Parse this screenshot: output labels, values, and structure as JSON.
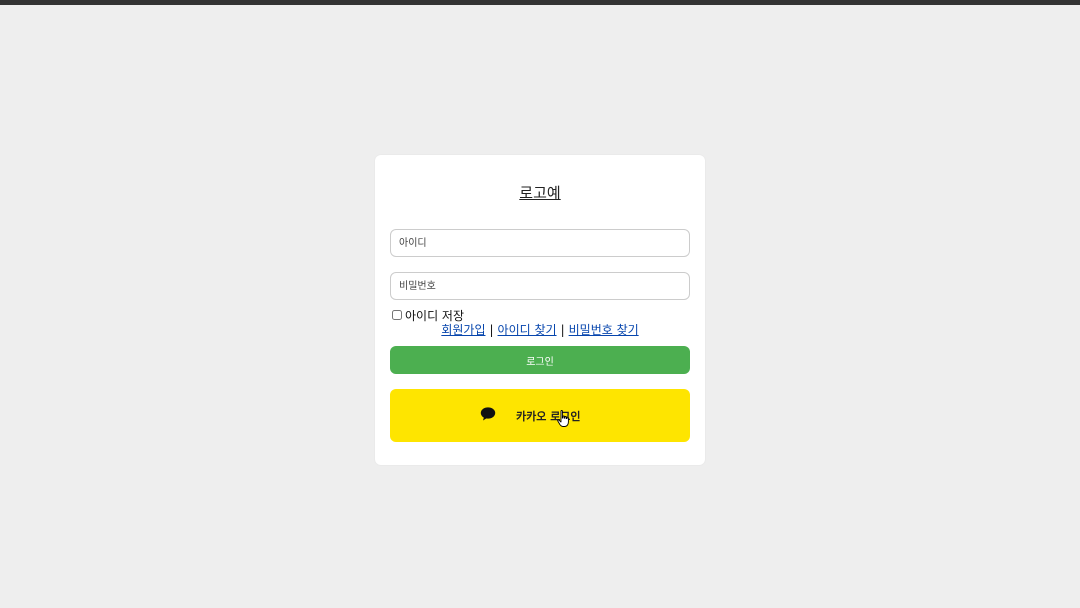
{
  "header": {
    "logo_text": "로고예"
  },
  "login_form": {
    "id_placeholder": "아이디",
    "password_placeholder": "비밀번호",
    "remember_label": "아이디 저장",
    "links": {
      "signup": "회원가입",
      "find_id": "아이디 찾기",
      "find_password": "비밀번호 찾기",
      "separator": "|"
    },
    "login_button": "로그인",
    "kakao_button": "카카오 로그인"
  },
  "colors": {
    "background": "#eeeeee",
    "card": "#ffffff",
    "login_button": "#4caf50",
    "kakao_button": "#fee500",
    "link": "#0645ad"
  },
  "icons": {
    "kakao": "speech-bubble-icon",
    "cursor": "hand-pointer-icon"
  }
}
